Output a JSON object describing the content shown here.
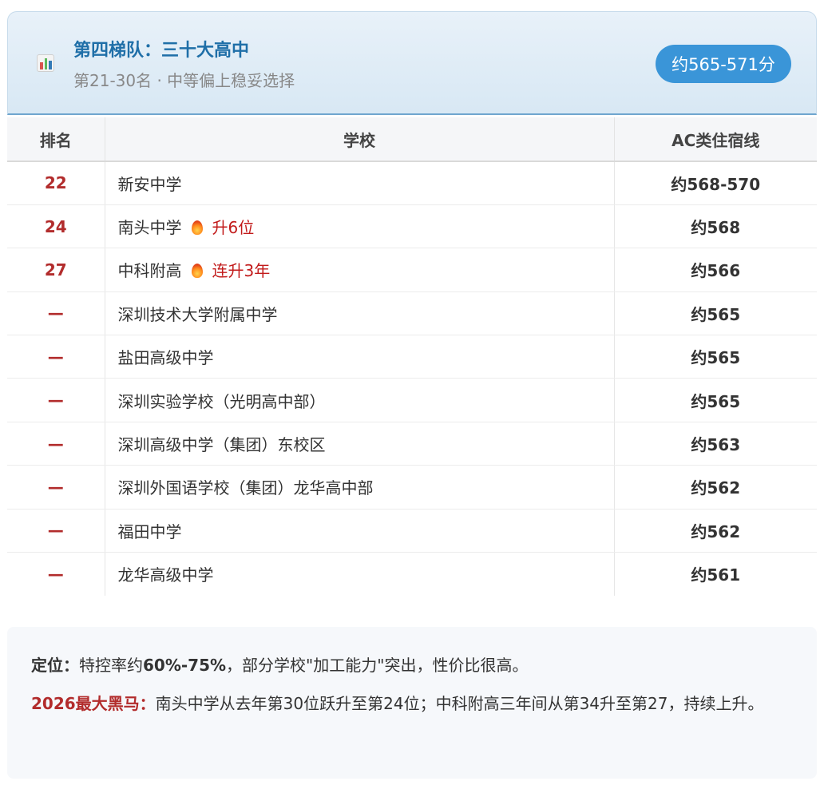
{
  "header": {
    "title": "第四梯队：三十大高中",
    "subtitle": "第21-30名 · 中等偏上稳妥选择",
    "badge": "约565-571分",
    "icon": "bar-chart-icon"
  },
  "table": {
    "columns": [
      "排名",
      "学校",
      "AC类住宿线"
    ],
    "rows": [
      {
        "rank": "22",
        "school": "新安中学",
        "tag": "",
        "line": "约568-570"
      },
      {
        "rank": "24",
        "school": "南头中学",
        "tag": "升6位",
        "line": "约568"
      },
      {
        "rank": "27",
        "school": "中科附高",
        "tag": "连升3年",
        "line": "约566"
      },
      {
        "rank": "—",
        "school": "深圳技术大学附属中学",
        "tag": "",
        "line": "约565"
      },
      {
        "rank": "—",
        "school": "盐田高级中学",
        "tag": "",
        "line": "约565"
      },
      {
        "rank": "—",
        "school": "深圳实验学校（光明高中部）",
        "tag": "",
        "line": "约565"
      },
      {
        "rank": "—",
        "school": "深圳高级中学（集团）东校区",
        "tag": "",
        "line": "约563"
      },
      {
        "rank": "—",
        "school": "深圳外国语学校（集团）龙华高中部",
        "tag": "",
        "line": "约562"
      },
      {
        "rank": "—",
        "school": "福田中学",
        "tag": "",
        "line": "约562"
      },
      {
        "rank": "—",
        "school": "龙华高级中学",
        "tag": "",
        "line": "约561"
      }
    ]
  },
  "note": {
    "positioning_label": "定位：",
    "positioning_pre": "特控率约",
    "positioning_bold": "60%-75%",
    "positioning_post": "，部分学校\"加工能力\"突出，性价比很高。",
    "darkhorse_label": "2026最大黑马：",
    "darkhorse_text": "南头中学从去年第30位跃升至第24位；中科附高三年间从第34升至第27，持续上升。"
  },
  "colors": {
    "accent": "#1f6fa8",
    "badge_bg": "#3a95d8",
    "rank_red": "#b22c2c",
    "tag_red": "#c21b1b"
  }
}
